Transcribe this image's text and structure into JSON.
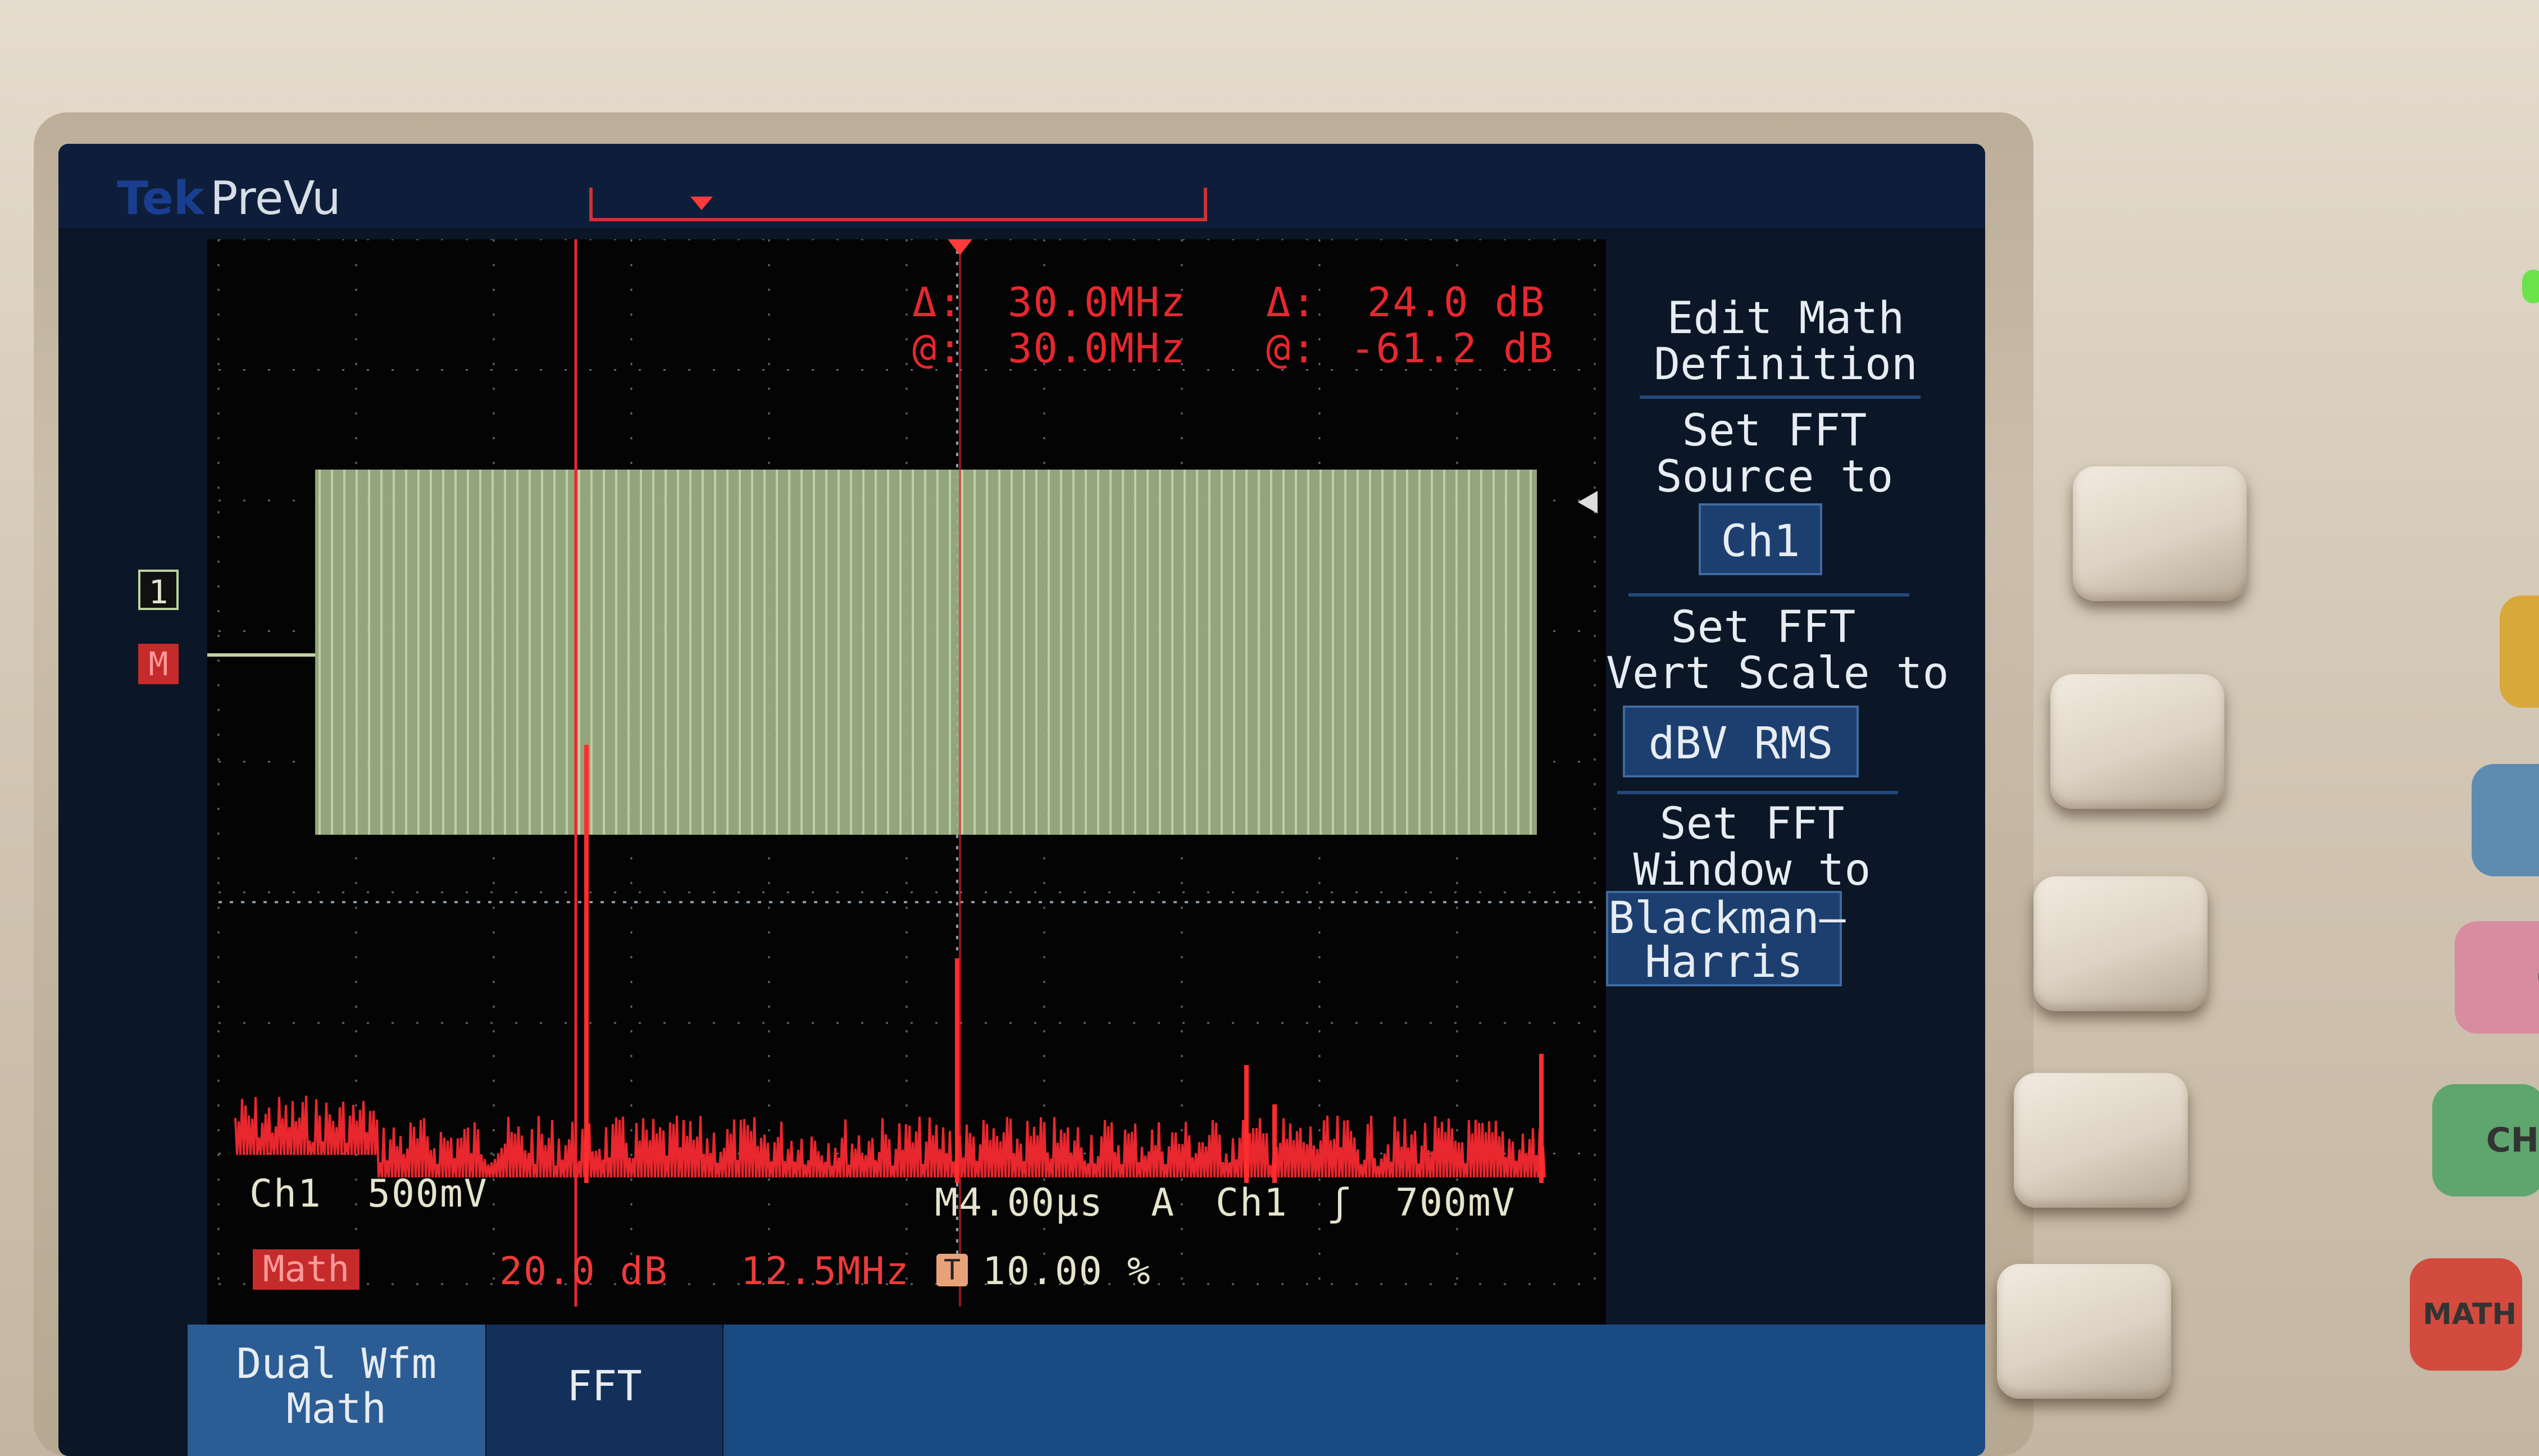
{
  "status_bar": {
    "brand": "Tek",
    "acquisition_state": "PreVu"
  },
  "cursor_readouts": {
    "delta_freq_label": "Δ:",
    "delta_freq_value": "30.0MHz",
    "at_freq_label": "@:",
    "at_freq_value": "30.0MHz",
    "delta_db_label": "Δ:",
    "delta_db_value": "24.0 dB",
    "at_db_label": "@:",
    "at_db_value": "-61.2 dB"
  },
  "markers": {
    "ch1": "1",
    "math": "M"
  },
  "channel_info": {
    "ch1_label": "Ch1",
    "ch1_scale": "500mV",
    "timebase": "M4.00μs",
    "trigger_mode": "A",
    "trigger_source": "Ch1",
    "trigger_slope": "ʃ",
    "trigger_level": "700mV"
  },
  "math_info": {
    "label": "Math",
    "scale": "20.0 dB",
    "freq": "12.5MHz",
    "trigger_badge": "T",
    "trigger_position": "10.00 %"
  },
  "side_menu": {
    "edit_math": "Edit Math\nDefinition",
    "fft_source_label": "Set FFT\nSource to",
    "fft_source_value": "Ch1",
    "fft_vert_label": "Set FFT\nVert Scale to",
    "fft_vert_value": "dBV RMS",
    "fft_window_label": "Set FFT\nWindow to",
    "fft_window_value": "Blackman–\nHarris"
  },
  "bottom_menu": {
    "dual_wfm": "Dual Wfm\nMath",
    "fft": "FFT"
  },
  "front_panel_buttons": {
    "ch_partial_1": "C",
    "ch_partial_2": "CH",
    "math_partial": "MATH"
  },
  "colors": {
    "ch1_trace": "#bfd1a0",
    "math_trace": "#e8272e",
    "screen_bg": "#0b1626",
    "menu_bg": "#1c3f6f"
  }
}
